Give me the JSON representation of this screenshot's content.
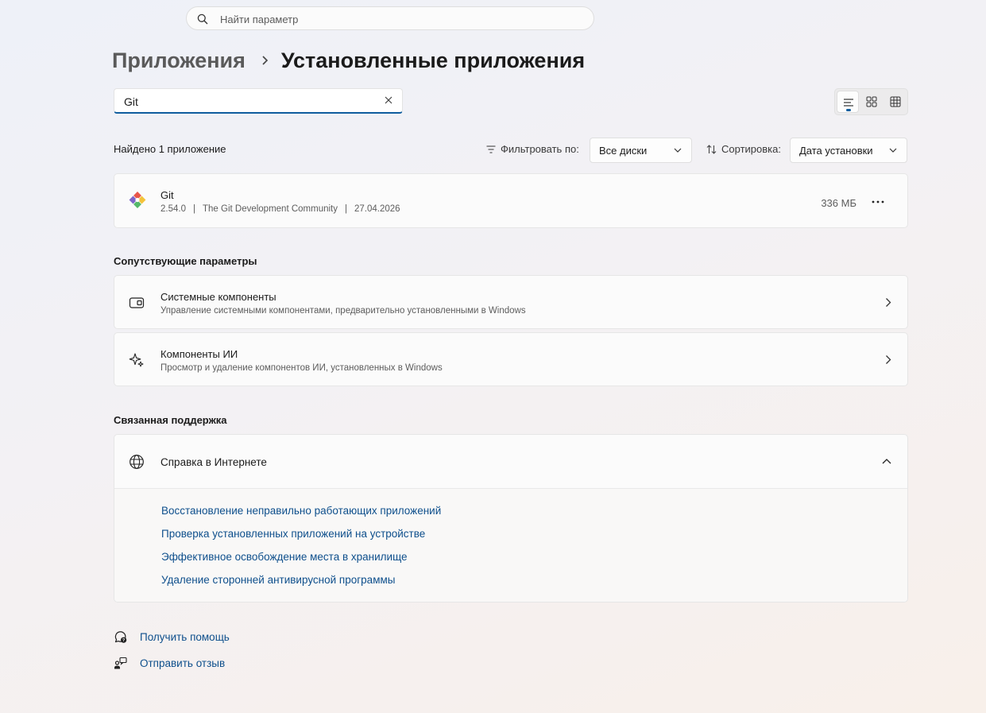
{
  "search": {
    "placeholder": "Найти параметр",
    "value": ""
  },
  "breadcrumb": {
    "parent": "Приложения",
    "current": "Установленные приложения"
  },
  "app_filter": {
    "value": "Git"
  },
  "view_modes": [
    "list",
    "tiles",
    "grid"
  ],
  "results": {
    "count_text": "Найдено 1 приложение"
  },
  "filter": {
    "label": "Фильтровать по:",
    "value": "Все диски"
  },
  "sort": {
    "label": "Сортировка:",
    "value": "Дата установки"
  },
  "apps": [
    {
      "name": "Git",
      "version": "2.54.0",
      "publisher": "The Git Development Community",
      "date": "27.04.2026",
      "size": "336 МБ",
      "separator": "|"
    }
  ],
  "related": {
    "title": "Сопутствующие параметры",
    "items": [
      {
        "title": "Системные компоненты",
        "subtitle": "Управление системными компонентами, предварительно установленными в Windows",
        "icon": "system-components-icon"
      },
      {
        "title": "Компоненты ИИ",
        "subtitle": "Просмотр и удаление компонентов ИИ, установленных в Windows",
        "icon": "sparkle-icon"
      }
    ]
  },
  "support": {
    "title": "Связанная поддержка",
    "help": {
      "title": "Справка в Интернете",
      "links": [
        "Восстановление неправильно работающих приложений",
        "Проверка установленных приложений на устройстве",
        "Эффективное освобождение места в хранилище",
        "Удаление сторонней антивирусной программы"
      ]
    }
  },
  "footer": {
    "get_help": "Получить помощь",
    "feedback": "Отправить отзыв"
  },
  "colors": {
    "accent": "#0f5d9e",
    "link": "#0e4f8c"
  }
}
